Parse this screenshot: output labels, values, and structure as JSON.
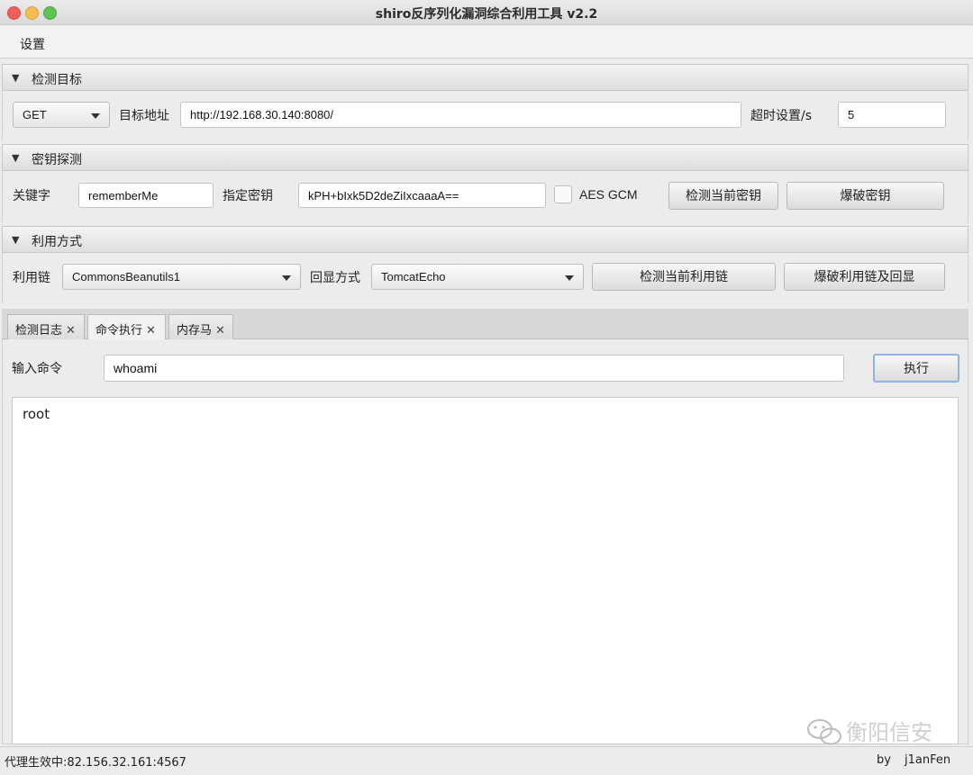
{
  "window": {
    "title": "shiro反序列化漏洞综合利用工具 v2.2"
  },
  "menu": {
    "settings": "设置"
  },
  "target": {
    "header": "检测目标",
    "method": "GET",
    "url_label": "目标地址",
    "url_value": "http://192.168.30.140:8080/",
    "timeout_label": "超时设置/s",
    "timeout_value": "5"
  },
  "key": {
    "header": "密钥探测",
    "keyword_label": "关键字",
    "keyword_value": "rememberMe",
    "key_label": "指定密钥",
    "key_value": "kPH+bIxk5D2deZiIxcaaaA==",
    "aes_gcm_label": "AES GCM",
    "detect_btn": "检测当前密钥",
    "brute_btn": "爆破密钥"
  },
  "exploit": {
    "header": "利用方式",
    "chain_label": "利用链",
    "chain_value": "CommonsBeanutils1",
    "echo_label": "回显方式",
    "echo_value": "TomcatEcho",
    "detect_btn": "检测当前利用链",
    "brute_btn": "爆破利用链及回显"
  },
  "tabs": [
    {
      "label": "检测日志",
      "close": "✕"
    },
    {
      "label": "命令执行",
      "close": "✕"
    },
    {
      "label": "内存马",
      "close": "✕"
    }
  ],
  "command": {
    "input_label": "输入命令",
    "input_value": "whoami",
    "exec_btn": "执行",
    "output": "root"
  },
  "status": {
    "proxy": "代理生效中:82.156.32.161:4567",
    "by": "by",
    "author": "j1anFen"
  },
  "watermark": {
    "text": "衡阳信安"
  },
  "colors": {
    "close": "#ee5f57",
    "minimize": "#f5bf4f",
    "zoom": "#5fc454",
    "focus": "#8fb4e2"
  }
}
